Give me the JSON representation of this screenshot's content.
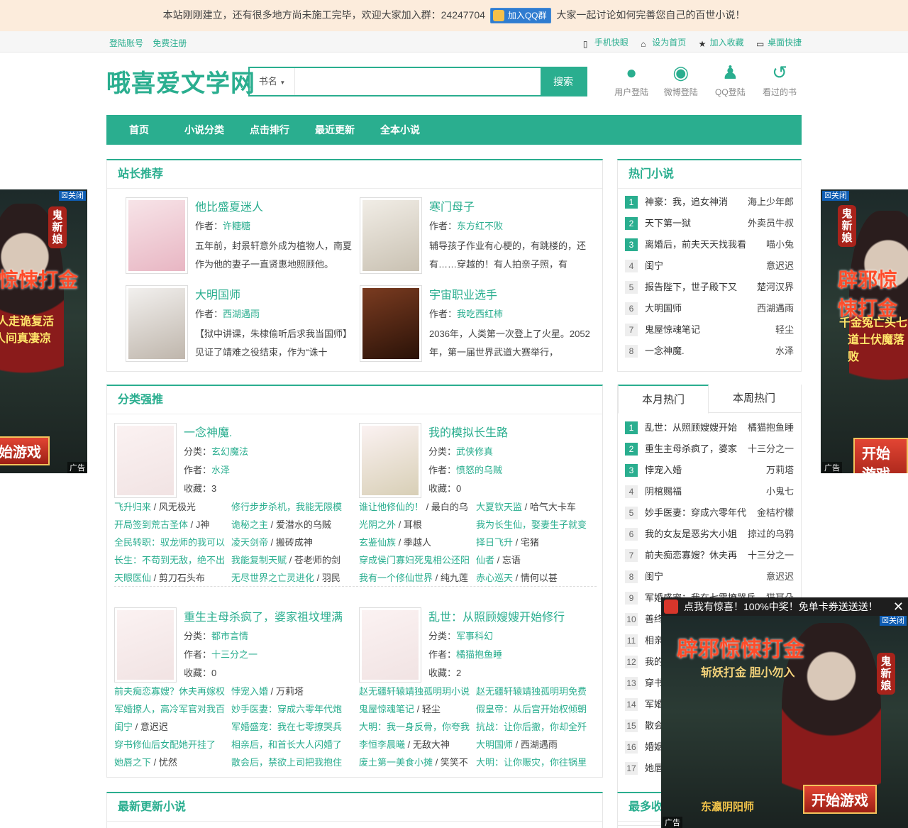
{
  "notice": {
    "text_before": "本站刚刚建立，还有很多地方尚未施工完毕，欢迎大家加入群：24247704",
    "qq_button": "加入QQ群",
    "text_after": "大家一起讨论如何完善您自己的百世小说！"
  },
  "topbar": {
    "login": "登陆账号",
    "register": "免费注册",
    "right": [
      {
        "icon": "mobile-icon",
        "label": "手机快眼"
      },
      {
        "icon": "home-icon",
        "label": "设为首页"
      },
      {
        "icon": "star-icon",
        "label": "加入收藏"
      },
      {
        "icon": "desktop-icon",
        "label": "桌面快捷"
      }
    ]
  },
  "header": {
    "logo": "哦喜爱文学网",
    "search": {
      "select": "书名",
      "placeholder": "",
      "button": "搜索"
    },
    "icons": [
      {
        "icon": "user-icon",
        "label": "用户登陆"
      },
      {
        "icon": "weibo-icon",
        "label": "微博登陆"
      },
      {
        "icon": "qq-icon",
        "label": "QQ登陆"
      },
      {
        "icon": "history-icon",
        "label": "看过的书"
      }
    ]
  },
  "nav": [
    "首页",
    "小说分类",
    "点击排行",
    "最近更新",
    "全本小说"
  ],
  "recommend": {
    "title": "站长推荐",
    "items": [
      {
        "title": "他比盛夏迷人",
        "author_label": "作者：",
        "author": "许糖糖",
        "desc": "五年前，封景轩意外成为植物人，南夏作为他的妻子一直贤惠地照顾他。",
        "cover": "#f3d7dc"
      },
      {
        "title": "寒门母子",
        "author_label": "作者：",
        "author": "东方红不败",
        "desc": "辅导孩子作业有心梗的，有跳楼的，还有……穿越的！有人拍亲子照，有",
        "cover": "#e9e6de"
      },
      {
        "title": "大明国师",
        "author_label": "作者：",
        "author": "西湖遇雨",
        "desc": "【狱中讲课，朱棣偷听后求我当国师】见证了靖难之役结束，作为“诛十",
        "cover": "#e8e4e0"
      },
      {
        "title": "宇宙职业选手",
        "author_label": "作者：",
        "author": "我吃西红柿",
        "desc": "2036年，人类第一次登上了火星。2052年，第一届世界武道大赛举行，",
        "cover": "#5a2a1e"
      }
    ]
  },
  "hot": {
    "title": "热门小说",
    "items": [
      {
        "n": "1",
        "name": "神豪：我，追女神消",
        "author": "海上少年郎"
      },
      {
        "n": "2",
        "name": "天下第一狱",
        "author": "外卖员牛叔"
      },
      {
        "n": "3",
        "name": "离婚后，前夫天天找我看",
        "author": "喵小兔"
      },
      {
        "n": "4",
        "name": "闺宁",
        "author": "意迟迟"
      },
      {
        "n": "5",
        "name": "报告陛下，世子殿下又",
        "author": "楚河汉界"
      },
      {
        "n": "6",
        "name": "大明国师",
        "author": "西湖遇雨"
      },
      {
        "n": "7",
        "name": "鬼屋惊魂笔记",
        "author": "轻尘"
      },
      {
        "n": "8",
        "name": "一念神魔.",
        "author": "水泽"
      }
    ]
  },
  "category": {
    "title": "分类强推",
    "blocks": [
      {
        "title": "一念神魔.",
        "cat_label": "分类：",
        "cat": "玄幻魔法",
        "author_label": "作者：",
        "author": "水泽",
        "fav_label": "收藏：",
        "fav": "3",
        "cover": "#f1e3e3"
      },
      {
        "title": "我的模拟长生路",
        "cat_label": "分类：",
        "cat": "武侠修真",
        "author_label": "作者：",
        "author": "愤怒的乌贼",
        "fav_label": "收藏：",
        "fav": "0",
        "cover": "#d8cfb6"
      },
      {
        "title": "重生主母杀疯了，婆家祖坟埋满",
        "cat_label": "分类：",
        "cat": "都市言情",
        "author_label": "作者：",
        "author": "十三分之一",
        "fav_label": "收藏：",
        "fav": "0",
        "cover": "#f1e3e3"
      },
      {
        "title": "乱世：从照顾嫂嫂开始修行",
        "cat_label": "分类：",
        "cat": "军事科幻",
        "author_label": "作者：",
        "author": "橘猫抱鱼睡",
        "fav_label": "收藏：",
        "fav": "2",
        "cover": "#f1e3e3"
      }
    ],
    "links": [
      [
        [
          "飞升归来",
          "风无极光"
        ],
        [
          "修行步步杀机，我能无限模",
          ""
        ],
        [
          "谁让他修仙的！",
          "最白的乌"
        ],
        [
          "大夏钦天监",
          "哈气大卡车"
        ]
      ],
      [
        [
          "开局签到荒古圣体",
          "J神"
        ],
        [
          "诡秘之主",
          "爱潜水的乌贼"
        ],
        [
          "光阴之外",
          "耳根"
        ],
        [
          "我为长生仙，娶妻生子就变",
          ""
        ]
      ],
      [
        [
          "全民转职：驭龙师的我可以",
          ""
        ],
        [
          "凌天剑帝",
          "搬砖成神"
        ],
        [
          "玄鉴仙族",
          "季越人"
        ],
        [
          "择日飞升",
          "宅猪"
        ]
      ],
      [
        [
          "长生：不苟到无敌，绝不出",
          ""
        ],
        [
          "我能复制天赋",
          "苍老师的剑"
        ],
        [
          "穿成侯门寡妇死鬼相公还阳",
          ""
        ],
        [
          "仙者",
          "忘语"
        ]
      ],
      [
        [
          "天眼医仙",
          "剪刀石头布"
        ],
        [
          "无尽世界之亡灵进化",
          "羽民"
        ],
        [
          "我有一个修仙世界",
          "纯九莲"
        ],
        [
          "赤心巡天",
          "情何以甚"
        ]
      ]
    ],
    "links2": [
      [
        [
          "前夫痴恋寡嫂？休夫再嫁权",
          ""
        ],
        [
          "悖宠入婚",
          "万莉塔"
        ],
        [
          "赵无疆轩辕靖独孤明玥小说",
          ""
        ],
        [
          "赵无疆轩辕靖独孤明玥免费",
          ""
        ]
      ],
      [
        [
          "军婚撩人，高冷军官对我百",
          ""
        ],
        [
          "妙手医妻：穿成六零年代炮",
          ""
        ],
        [
          "鬼屋惊魂笔记",
          "轻尘"
        ],
        [
          "假皇帝：从后宫开始权倾朝",
          ""
        ]
      ],
      [
        [
          "闺宁",
          "意迟迟"
        ],
        [
          "军婚盛宠：我在七零撩哭兵",
          ""
        ],
        [
          "大明：我一身反骨，你夸我",
          ""
        ],
        [
          "抗战：让你后撤，你却全歼",
          ""
        ]
      ],
      [
        [
          "穿书修仙后女配她开挂了",
          ""
        ],
        [
          "相亲后，和首长大人闪婚了",
          ""
        ],
        [
          "李恒李晨曦",
          "无敌大神"
        ],
        [
          "大明国师",
          "西湖遇雨"
        ]
      ],
      [
        [
          "她唇之下",
          "忧然"
        ],
        [
          "散会后，禁欲上司把我抱住",
          ""
        ],
        [
          "废土第一美食小摊",
          "笑笑不"
        ],
        [
          "大明：让你赈灾，你往锅里",
          ""
        ]
      ]
    ]
  },
  "monthly": {
    "tabs": [
      "本月热门",
      "本周热门"
    ],
    "items": [
      {
        "n": "1",
        "name": "乱世：从照顾嫂嫂开始",
        "author": "橘猫抱鱼睡"
      },
      {
        "n": "2",
        "name": "重生主母杀疯了，婆家",
        "author": "十三分之一"
      },
      {
        "n": "3",
        "name": "悖宠入婚",
        "author": "万莉塔"
      },
      {
        "n": "4",
        "name": "阴棺赐福",
        "author": "小鬼七"
      },
      {
        "n": "5",
        "name": "妙手医妻：穿成六零年代",
        "author": "金桔柠檬"
      },
      {
        "n": "6",
        "name": "我的女友是恶劣大小姐",
        "author": "掠过的乌鸦"
      },
      {
        "n": "7",
        "name": "前夫痴恋寡嫂？休夫再",
        "author": "十三分之一"
      },
      {
        "n": "8",
        "name": "闺宁",
        "author": "意迟迟"
      },
      {
        "n": "9",
        "name": "军婚盛宠：我在七零撩哭兵",
        "author": "猫耳朵"
      },
      {
        "n": "10",
        "name": "善终",
        "author": ""
      },
      {
        "n": "11",
        "name": "相亲",
        "author": ""
      },
      {
        "n": "12",
        "name": "我的",
        "author": ""
      },
      {
        "n": "13",
        "name": "穿书",
        "author": ""
      },
      {
        "n": "14",
        "name": "军婚",
        "author": ""
      },
      {
        "n": "15",
        "name": "散会",
        "author": ""
      },
      {
        "n": "16",
        "name": "婚姻",
        "author": ""
      },
      {
        "n": "17",
        "name": "她唇",
        "author": ""
      }
    ]
  },
  "latest": {
    "title": "最新更新小说"
  },
  "most_fav": {
    "title": "最多收"
  },
  "ads": {
    "close": "关闭",
    "tag": "广告",
    "title": "辟邪惊悚打金",
    "sub": "斩妖打金 胆小勿入",
    "bride": "鬼新娘",
    "button": "开始游戏",
    "brand": "东瀛阴阳师",
    "side_left_lines": [
      "亲人走诡复活",
      "人间真凄凉"
    ],
    "side_right_lines": [
      "千金冤亡头七",
      "道士伏魔落败"
    ],
    "popup_bar": "点我有惊喜！100%中奖！免单卡券送送送！",
    "popup_close": "✕"
  }
}
